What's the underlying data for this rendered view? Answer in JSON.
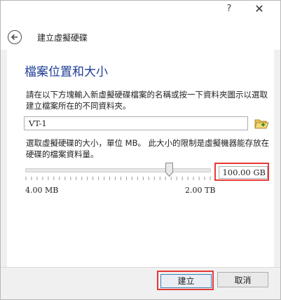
{
  "window": {
    "help_label": "?",
    "close_label": "✕"
  },
  "header": {
    "title": "建立虛擬硬碟",
    "back_icon": "back-arrow-icon"
  },
  "main": {
    "section_title": "檔案位置和大小",
    "location_description": "請在以下方塊輸入新虛擬硬碟檔案的名稱或按一下資料夾圖示以選取建立檔案所在的不同資料夾。",
    "file_name": "VT-1",
    "folder_icon": "folder-open-icon",
    "size_description": "選取虛擬硬碟的大小，單位 MB。 此大小的限制是虛擬機器能存放在硬碟的檔案資料量。",
    "size_value": "100.00 GB",
    "slider_level": 0.78,
    "min_label": "4.00 MB",
    "max_label": "2.00 TB"
  },
  "footer": {
    "create_label": "建立",
    "cancel_label": "取消"
  },
  "colors": {
    "accent_title": "#1e3e96",
    "highlight_border": "#e53935"
  }
}
